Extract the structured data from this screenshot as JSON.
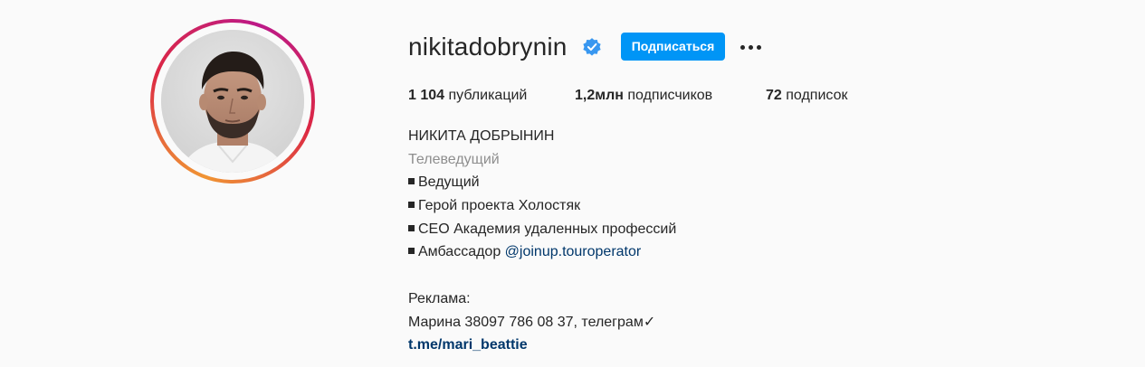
{
  "profile": {
    "username": "nikitadobrynin",
    "follow_label": "Подписаться",
    "icons": {
      "verified": "verified-badge-icon",
      "more": "more-options-icon"
    },
    "colors": {
      "accent": "#0095f6",
      "verified": "#3897f0",
      "link": "#00376b",
      "muted": "#8e8e8e"
    }
  },
  "stats": {
    "posts_count": "1 104",
    "posts_label": "публикаций",
    "followers_count": "1,2млн",
    "followers_label": "подписчиков",
    "following_count": "72",
    "following_label": "подписок"
  },
  "bio": {
    "full_name": "НИКИТА ДОБРЫНИН",
    "category": "Телеведущий",
    "items": [
      "Ведущий",
      "Герой проекта Холостяк",
      "CEO Академия удаленных профессий",
      "Амбассадор"
    ],
    "mention": "@joinup.touroperator",
    "ad_label": "Реклама:",
    "contact": "Марина 38097 786 08 37, телеграм✓",
    "website": "t.me/mari_beattie"
  }
}
